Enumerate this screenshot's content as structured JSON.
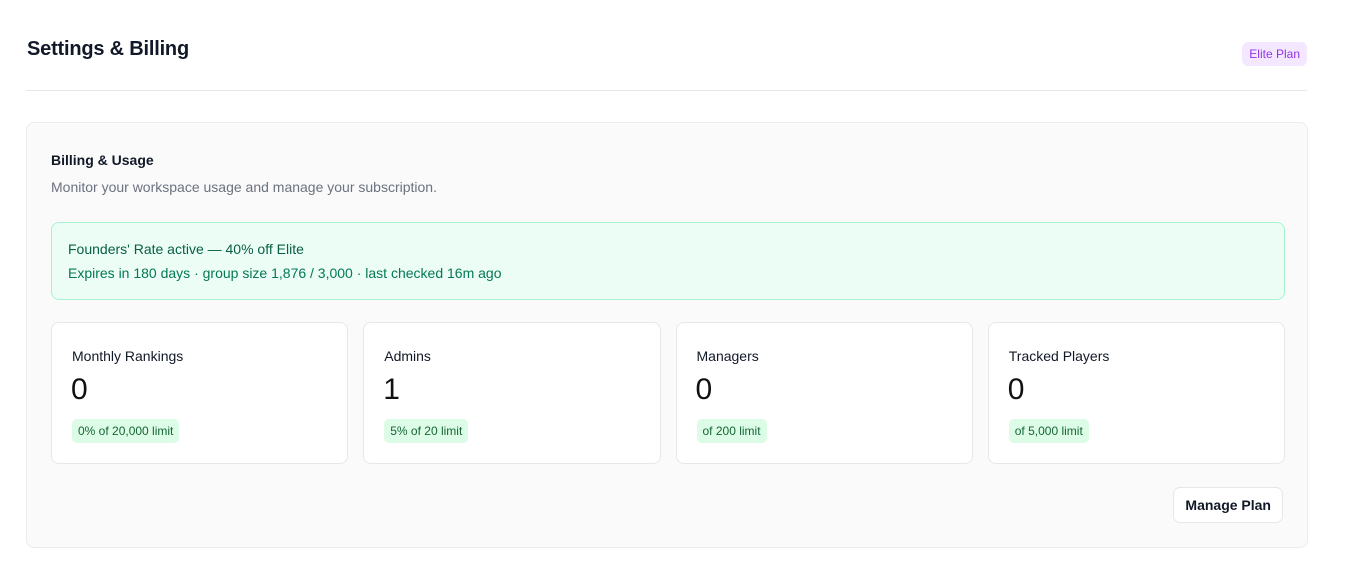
{
  "header": {
    "title": "Settings & Billing",
    "plan_badge": "Elite Plan"
  },
  "billing": {
    "title": "Billing & Usage",
    "description": "Monitor your workspace usage and manage your subscription.",
    "promo": {
      "title": "Founders' Rate active — 40% off Elite",
      "detail": "Expires in 180 days · group size 1,876 / 3,000 · last checked 16m ago"
    },
    "stats": [
      {
        "label": "Monthly Rankings",
        "value": "0",
        "limit": "0% of 20,000 limit"
      },
      {
        "label": "Admins",
        "value": "1",
        "limit": "5% of 20 limit"
      },
      {
        "label": "Managers",
        "value": "0",
        "limit": "of 200 limit"
      },
      {
        "label": "Tracked Players",
        "value": "0",
        "limit": "of 5,000 limit"
      }
    ],
    "manage_button": "Manage Plan"
  },
  "colors": {
    "plan_badge_text": "#9333ea",
    "plan_badge_bg": "#f3e8ff",
    "promo_bg": "#ecfdf5",
    "promo_text": "#065f46",
    "limit_badge_bg": "#dcfce7",
    "limit_badge_text": "#166534"
  }
}
